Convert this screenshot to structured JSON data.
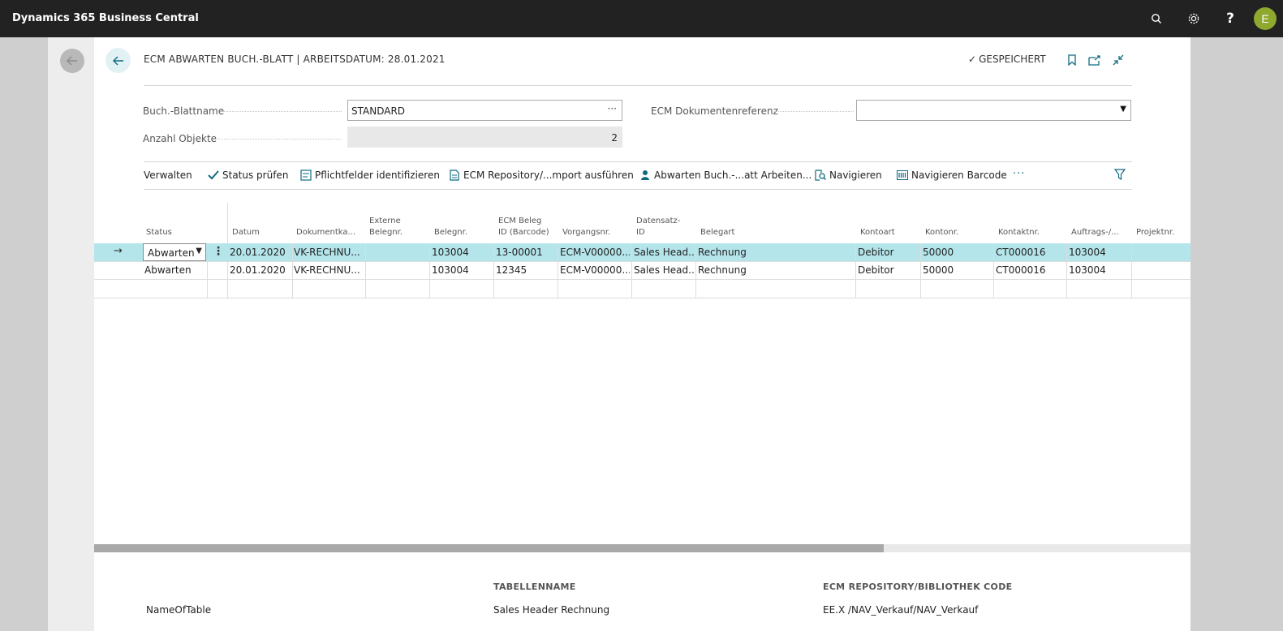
{
  "app": {
    "title": "Dynamics 365 Business Central",
    "user_initial": "E",
    "icons": [
      "search-icon",
      "settings-icon",
      "help-icon"
    ],
    "help_glyph": "?"
  },
  "page": {
    "title": "ECM ABWARTEN BUCH.-BLATT | ARBEITSDATUM: 28.01.2021",
    "saved_label": "GESPEICHERT"
  },
  "fields": {
    "batch_name_label": "Buch.-Blattname",
    "batch_name_value": "STANDARD",
    "count_label": "Anzahl Objekte",
    "count_value": "2",
    "doc_ref_label": "ECM Dokumentenreferenz",
    "doc_ref_value": ""
  },
  "actions": {
    "manage": "Verwalten",
    "check_status": "Status prüfen",
    "identify_required": "Pflichtfelder identifizieren",
    "repository_import": "ECM Repository/...mport ausführen",
    "await_journal": "Abwarten Buch.-...att Arbeiten...",
    "navigate": "Navigieren",
    "navigate_barcode": "Navigieren Barcode",
    "more": "···"
  },
  "table": {
    "columns": {
      "status": "Status",
      "datum": "Datum",
      "dokumentka": "Dokumentka...",
      "externe1": "Externe",
      "externe2": "Belegnr.",
      "belegnr": "Belegnr.",
      "ecm1": "ECM Beleg",
      "ecm2": "ID (Barcode)",
      "vorgangsnr": "Vorgangsnr.",
      "datensatz1": "Datensatz-",
      "datensatz2": "ID",
      "belegart": "Belegart",
      "kontoart": "Kontoart",
      "kontonr": "Kontonr.",
      "kontaktnr": "Kontaktnr.",
      "auftrags": "Auftrags-/...",
      "projektnr": "Projektnr."
    },
    "rows": [
      {
        "status": "Abwarten",
        "datum": "20.01.2020",
        "dokumentka": "VK-RECHNU...",
        "externe": "",
        "belegnr": "103004",
        "ecm": "13-00001",
        "vorgangsnr": "ECM-V00000...",
        "datensatz": "Sales Head...",
        "belegart": "Rechnung",
        "kontoart": "Debitor",
        "kontonr": "50000",
        "kontaktnr": "CT000016",
        "auftrags": "103004",
        "projektnr": ""
      },
      {
        "status": "Abwarten",
        "datum": "20.01.2020",
        "dokumentka": "VK-RECHNU...",
        "externe": "",
        "belegnr": "103004",
        "ecm": "12345",
        "vorgangsnr": "ECM-V00000...",
        "datensatz": "Sales Head...",
        "belegart": "Rechnung",
        "kontoart": "Debitor",
        "kontonr": "50000",
        "kontaktnr": "CT000016",
        "auftrags": "103004",
        "projektnr": ""
      }
    ]
  },
  "factbox": {
    "name_value": "NameOfTable",
    "table_name_head": "TABELLENNAME",
    "table_name_value": "Sales Header Rechnung",
    "repo_head": "ECM REPOSITORY/BIBLIOTHEK CODE",
    "repo_value": "EE.X /NAV_Verkauf/NAV_Verkauf"
  },
  "colors": {
    "appbar": "#222222",
    "accent": "#0f6a80",
    "selected_row": "#b4e5eb",
    "avatar": "#8fa82e"
  }
}
